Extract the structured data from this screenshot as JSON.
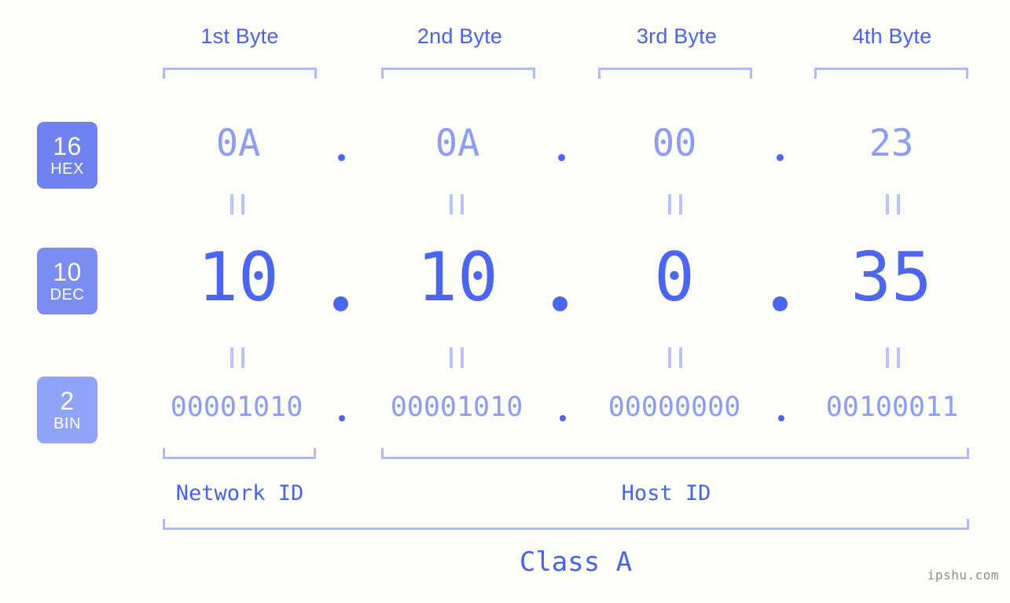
{
  "background": "#fdfdfa",
  "colors": {
    "accent_strong": "#4c66ef",
    "accent_label": "#4762f0",
    "accent_light": "#8b9df6",
    "bracket": "#aeb9fb",
    "badge_dark": "#6f82ef",
    "badge_light": "#8fa3f7",
    "watermark": "#8d8d8d"
  },
  "byte_headers": [
    {
      "label": "1st Byte"
    },
    {
      "label": "2nd Byte"
    },
    {
      "label": "3rd Byte"
    },
    {
      "label": "4th Byte"
    }
  ],
  "rows": [
    {
      "badge_number": "16",
      "badge_name": "HEX",
      "values": [
        "0A",
        "0A",
        "00",
        "23"
      ],
      "separator": "."
    },
    {
      "badge_number": "10",
      "badge_name": "DEC",
      "values": [
        "10",
        "10",
        "0",
        "35"
      ],
      "separator": "."
    },
    {
      "badge_number": "2",
      "badge_name": "BIN",
      "values": [
        "00001010",
        "00001010",
        "00000000",
        "00100011"
      ],
      "separator": "."
    }
  ],
  "equals_symbol": "=",
  "sections": [
    {
      "label": "Network ID"
    },
    {
      "label": "Host ID"
    }
  ],
  "class": {
    "label": "Class A"
  },
  "watermark": {
    "text": "ipshu.com"
  }
}
